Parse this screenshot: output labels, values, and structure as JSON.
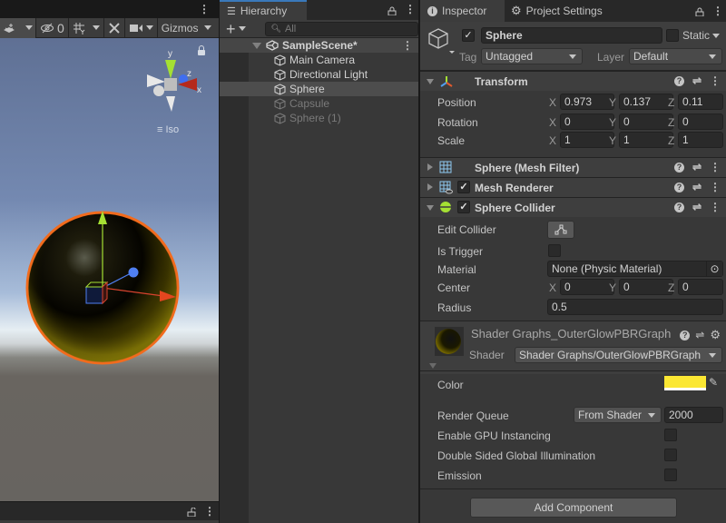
{
  "scene_view": {
    "toolbar": {
      "hidden_count": "0",
      "gizmos_label": "Gizmos"
    },
    "orientation": {
      "y_label": "y",
      "z_label": "z",
      "x_label": "x",
      "projection_label": "Iso"
    }
  },
  "hierarchy": {
    "tab_label": "Hierarchy",
    "search_placeholder": "All",
    "scene_name": "SampleScene*",
    "items": [
      {
        "label": "Main Camera",
        "state": "normal"
      },
      {
        "label": "Directional Light",
        "state": "normal"
      },
      {
        "label": "Sphere",
        "state": "selected"
      },
      {
        "label": "Capsule",
        "state": "disabled"
      },
      {
        "label": "Sphere (1)",
        "state": "disabled"
      }
    ]
  },
  "inspector": {
    "tabs": [
      {
        "label": "Inspector",
        "icon": "info-icon",
        "active": true
      },
      {
        "label": "Project Settings",
        "icon": "gear-icon",
        "active": false
      }
    ],
    "gameobject": {
      "active": true,
      "name": "Sphere",
      "static_label": "Static",
      "static": false,
      "tag_label": "Tag",
      "tag_value": "Untagged",
      "layer_label": "Layer",
      "layer_value": "Default"
    },
    "transform": {
      "title": "Transform",
      "rows": [
        {
          "label": "Position",
          "x": "0.973",
          "y": "0.137",
          "z": "0.11"
        },
        {
          "label": "Rotation",
          "x": "0",
          "y": "0",
          "z": "0"
        },
        {
          "label": "Scale",
          "x": "1",
          "y": "1",
          "z": "1"
        }
      ]
    },
    "mesh_filter": {
      "title": "Sphere (Mesh Filter)"
    },
    "mesh_renderer": {
      "title": "Mesh Renderer",
      "enabled": true
    },
    "sphere_collider": {
      "title": "Sphere Collider",
      "enabled": true,
      "edit_collider_label": "Edit Collider",
      "is_trigger_label": "Is Trigger",
      "is_trigger": false,
      "material_label": "Material",
      "material_value": "None (Physic Material)",
      "center_label": "Center",
      "center": {
        "x": "0",
        "y": "0",
        "z": "0"
      },
      "radius_label": "Radius",
      "radius": "0.5"
    },
    "material": {
      "title": "Shader Graphs_OuterGlowPBRGraph",
      "shader_label": "Shader",
      "shader_value": "Shader Graphs/OuterGlowPBRGraph",
      "color_label": "Color",
      "color_value": "#fbe733",
      "render_queue_label": "Render Queue",
      "render_queue_mode": "From Shader",
      "render_queue_value": "2000",
      "gpu_instancing_label": "Enable GPU Instancing",
      "gpu_instancing": false,
      "double_sided_gi_label": "Double Sided Global Illumination",
      "double_sided_gi": false,
      "emission_label": "Emission",
      "emission": false
    },
    "add_component_label": "Add Component"
  },
  "axis_labels": {
    "x": "X",
    "y": "Y",
    "z": "Z"
  },
  "colors": {
    "accent_tab": "#3a79bb",
    "selection_outline": "#f26b1d",
    "axis_x": "#d8432e",
    "axis_y": "#a5e033",
    "axis_z": "#4f7ff2"
  }
}
